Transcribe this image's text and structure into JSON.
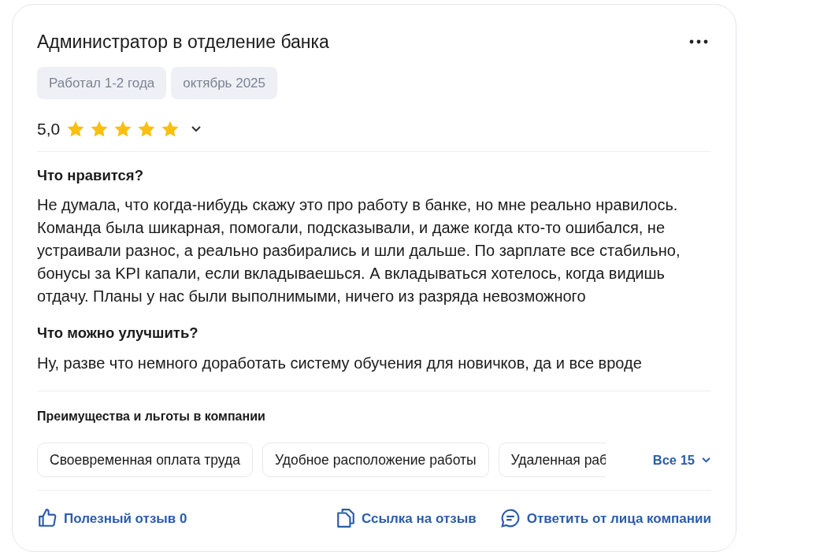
{
  "review": {
    "title": "Администратор в отделение банка",
    "tags": [
      "Работал 1-2 года",
      "октябрь 2025"
    ],
    "rating": "5,0",
    "stars": 5,
    "sections": [
      {
        "heading": "Что нравится?",
        "text": "Не думала, что когда-нибудь скажу это про работу в банке, но мне реально нравилось. Команда была шикарная, помогали, подсказывали, и даже когда кто-то ошибался, не устраивали разнос, а реально разбирались и шли дальше. По зарплате все стабильно, бонусы за KPI капали, если вкладываешься. А вкладываться хотелось, когда видишь отдачу. Планы у нас были выполнимыми, ничего из разряда невозможного"
      },
      {
        "heading": "Что можно улучшить?",
        "text": "Ну, разве что немного доработать систему обучения для новичков, да и все вроде"
      }
    ],
    "benefits": {
      "heading": "Преимущества и льготы в компании",
      "chips": [
        "Своевременная оплата труда",
        "Удобное расположение работы",
        "Удаленная раб"
      ],
      "more": "Все 15"
    },
    "actions": [
      {
        "kind": "like",
        "label": "Полезный отзыв 0"
      },
      {
        "kind": "link",
        "label": "Ссылка на отзыв"
      },
      {
        "kind": "reply",
        "label": "Ответить от лица компании"
      }
    ]
  }
}
